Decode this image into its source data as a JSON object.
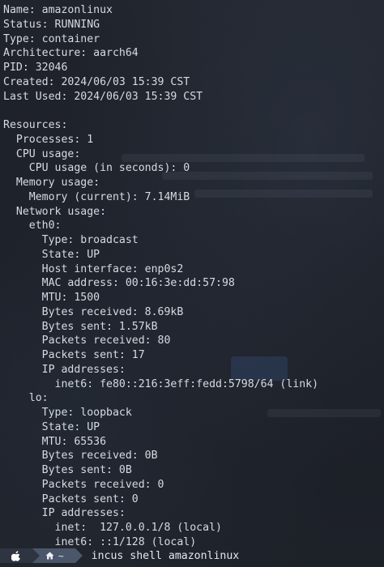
{
  "terminal": {
    "lines": [
      "Name: amazonlinux",
      "Status: RUNNING",
      "Type: container",
      "Architecture: aarch64",
      "PID: 32046",
      "Created: 2024/06/03 15:39 CST",
      "Last Used: 2024/06/03 15:39 CST",
      "",
      "Resources:",
      "  Processes: 1",
      "  CPU usage:",
      "    CPU usage (in seconds): 0",
      "  Memory usage:",
      "    Memory (current): 7.14MiB",
      "  Network usage:",
      "    eth0:",
      "      Type: broadcast",
      "      State: UP",
      "      Host interface: enp0s2",
      "      MAC address: 00:16:3e:dd:57:98",
      "      MTU: 1500",
      "      Bytes received: 8.69kB",
      "      Bytes sent: 1.57kB",
      "      Packets received: 80",
      "      Packets sent: 17",
      "      IP addresses:",
      "        inet6: fe80::216:3eff:fedd:5798/64 (link)",
      "    lo:",
      "      Type: loopback",
      "      State: UP",
      "      MTU: 65536",
      "      Bytes received: 0B",
      "      Bytes sent: 0B",
      "      Packets received: 0",
      "      Packets sent: 0",
      "      IP addresses:",
      "        inet:  127.0.0.1/8 (local)",
      "        inet6: ::1/128 (local)"
    ]
  },
  "prompt": {
    "os_icon": "apple-icon",
    "home_icon": "home-icon",
    "path": "~",
    "command": "incus shell amazonlinux"
  },
  "colors": {
    "background": "#1c1f26",
    "text": "#d7dae0",
    "prompt_segment_dark": "#2e3440",
    "prompt_segment_mid": "#4c566a"
  }
}
